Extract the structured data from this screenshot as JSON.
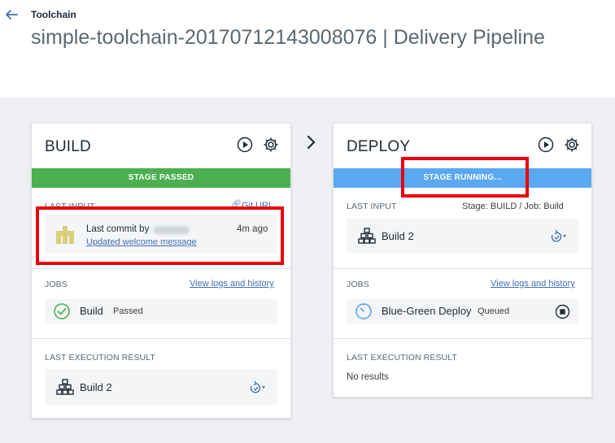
{
  "header": {
    "breadcrumb": "Toolchain",
    "title": "simple-toolchain-20170712143008076 | Delivery Pipeline"
  },
  "stages": {
    "build": {
      "title": "BUILD",
      "status": "STAGE PASSED",
      "last_input_label": "LAST INPUT",
      "input_link": "Git URL",
      "commit_prefix": "Last commit by",
      "commit_time": "4m ago",
      "commit_message": "Updated welcome message",
      "jobs_label": "JOBS",
      "jobs_link": "View logs and history",
      "job_name": "Build",
      "job_status": "Passed",
      "last_exec_label": "LAST EXECUTION RESULT",
      "last_exec_value": "Build 2"
    },
    "deploy": {
      "title": "DEPLOY",
      "status": "STAGE RUNNING...",
      "last_input_label": "LAST INPUT",
      "input_meta": "Stage: BUILD  /  Job: Build",
      "input_value": "Build 2",
      "jobs_label": "JOBS",
      "jobs_link": "View logs and history",
      "job_name": "Blue-Green Deploy",
      "job_status": "Queued",
      "last_exec_label": "LAST EXECUTION RESULT",
      "last_exec_value": "No results"
    }
  },
  "colors": {
    "passed": "#4caf50",
    "running": "#5aa8f0",
    "link": "#3d70b2",
    "highlight": "#e8000b"
  },
  "icons": [
    "back-arrow-icon",
    "play-icon",
    "gear-icon",
    "chevron-right-icon",
    "link-icon",
    "commit-avatar",
    "check-circle-icon",
    "build-artifact-icon",
    "refresh-deploy-icon",
    "queued-clock-icon",
    "stop-icon"
  ]
}
